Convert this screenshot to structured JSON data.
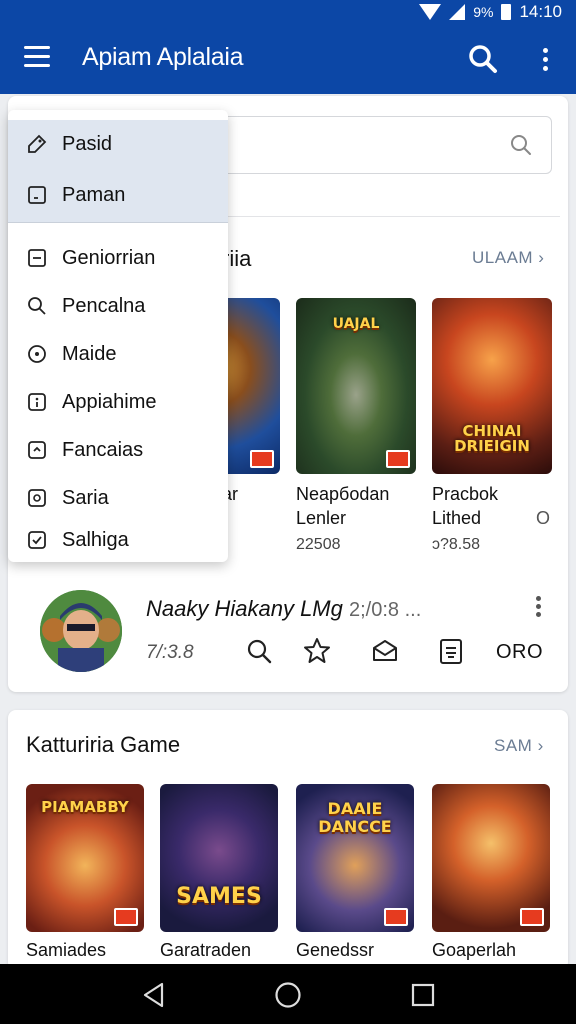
{
  "status_bar": {
    "battery": "9%",
    "time": "14:10"
  },
  "app_bar": {
    "title": "Apiam Aplalaia",
    "icons": [
      "menu-icon",
      "search-icon",
      "more-vert-icon"
    ]
  },
  "search": {
    "placeholder": ""
  },
  "section1": {
    "title": "Geniorrian riia",
    "title_visible_suffix": "riia",
    "see_all": "ULAAM",
    "games": [
      {
        "name_line1": "ar",
        "name_line2": "",
        "count": ""
      },
      {
        "name_line1": "Neapбodan",
        "name_line2": "Lenler",
        "count": "22508"
      },
      {
        "name_line1": "Pracbok",
        "name_line2": "Lithed",
        "count": "ɔ?8.58",
        "extra": "O"
      }
    ],
    "tile_logos": [
      "",
      "UAJAL",
      "CHINAI DRIEIGIN"
    ]
  },
  "featured": {
    "title": "Naaky Hiakany LMg",
    "title_dim": "2;/0:8 ...",
    "count": "7/:3.8",
    "label": "ORO",
    "actions": [
      "search-icon",
      "star-icon",
      "mail-open-icon",
      "clipboard-icon"
    ]
  },
  "drawer": {
    "items": [
      {
        "label": "Pasid",
        "icon": "tag-icon",
        "highlight": true
      },
      {
        "label": "Paman",
        "icon": "square-icon",
        "highlight": true
      },
      {
        "label": "Geniorrian",
        "icon": "minus-box-icon",
        "highlight": false
      },
      {
        "label": "Pencalna",
        "icon": "search-alt-icon",
        "highlight": false
      },
      {
        "label": "Maide",
        "icon": "target-icon",
        "highlight": false
      },
      {
        "label": "Appiahime",
        "icon": "info-box-icon",
        "highlight": false
      },
      {
        "label": "Fancaias",
        "icon": "arrow-box-icon",
        "highlight": false
      },
      {
        "label": "Saria",
        "icon": "clock-box-icon",
        "highlight": false
      },
      {
        "label": "Salhiga",
        "icon": "check-box-icon",
        "highlight": false
      }
    ]
  },
  "section2": {
    "title": "Katturiria Game",
    "see_all": "SAM",
    "games": [
      {
        "name": "Samiades",
        "logo": "PIAMABBY"
      },
      {
        "name": "Garatraden",
        "logo": "SAMES"
      },
      {
        "name": "Genedssr",
        "logo": "DAAIE DANCCE"
      },
      {
        "name": "Goaperlah",
        "logo": ""
      }
    ]
  },
  "colors": {
    "brand": "#0c47a6",
    "drawer_highlight": "#dfe6f0",
    "see_all": "#6b7c93"
  }
}
